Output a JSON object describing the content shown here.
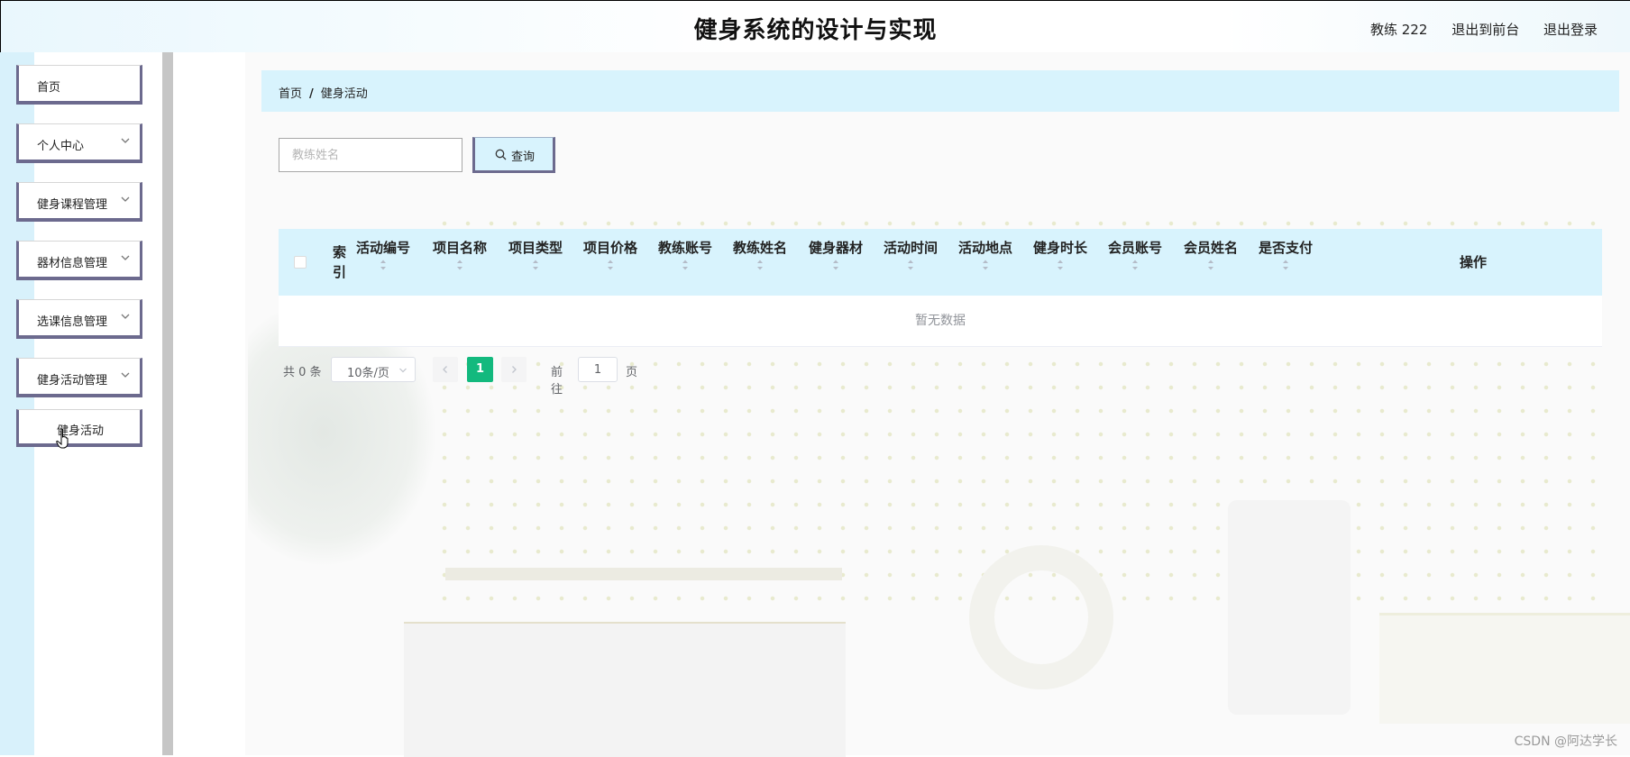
{
  "header": {
    "title": "健身系统的设计与实现",
    "user": "教练 222",
    "back_to_front": "退出到前台",
    "logout": "退出登录"
  },
  "sidebar": {
    "items": [
      {
        "label": "首页",
        "icon": "none"
      },
      {
        "label": "个人中心",
        "icon": "chevron-down-icon"
      },
      {
        "label": "健身课程管理",
        "icon": "chevron-down-icon"
      },
      {
        "label": "器材信息管理",
        "icon": "chevron-down-icon"
      },
      {
        "label": "选课信息管理",
        "icon": "chevron-down-icon"
      },
      {
        "label": "健身活动管理",
        "icon": "chevron-down-icon"
      },
      {
        "label": "健身活动",
        "icon": "none",
        "submenu": true
      }
    ]
  },
  "breadcrumb": {
    "home": "首页",
    "separator": "/",
    "current": "健身活动"
  },
  "search": {
    "placeholder": "教练姓名",
    "button_label": "查询"
  },
  "table": {
    "index_header": "索引",
    "columns": [
      "活动编号",
      "项目名称",
      "项目类型",
      "项目价格",
      "教练账号",
      "教练姓名",
      "健身器材",
      "活动时间",
      "活动地点",
      "健身时长",
      "会员账号",
      "会员姓名",
      "是否支付"
    ],
    "operation_header": "操作",
    "empty_text": "暂无数据"
  },
  "pagination": {
    "total": "共 0 条",
    "page_size": "10条/页",
    "current_page": "1",
    "goto_prefix": "前往",
    "goto_value": "1",
    "goto_suffix": "页"
  },
  "watermark": "CSDN @阿达学长",
  "colors": {
    "accent": "#d8f3fd",
    "menu_border": "#6c6a8e",
    "page_active": "#13b97e"
  }
}
